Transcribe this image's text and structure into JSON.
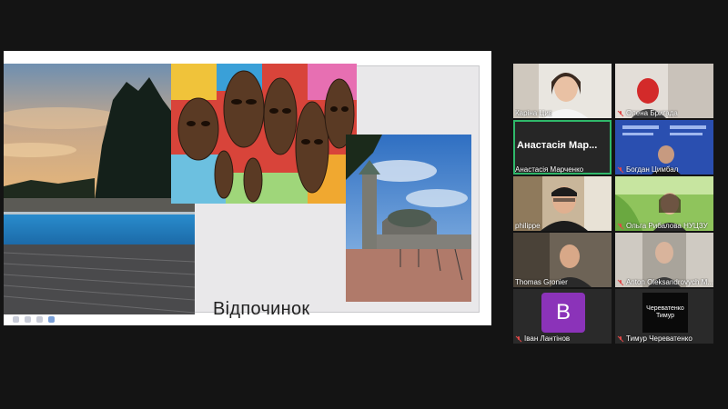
{
  "slide": {
    "title": "Відпочинок"
  },
  "participants": [
    {
      "name": "Каріна Цив",
      "muted": false,
      "kind": "video"
    },
    {
      "name": "Олена Бригада",
      "muted": true,
      "kind": "video"
    },
    {
      "name": "Анастасія Марченко",
      "muted": false,
      "kind": "name-card",
      "card_text": "Анастасія Мар..."
    },
    {
      "name": "Богдан Цимбал",
      "muted": true,
      "kind": "video"
    },
    {
      "name": "philippe",
      "muted": false,
      "kind": "video"
    },
    {
      "name": "Ольга Рибалова НУЦЗУ",
      "muted": true,
      "kind": "video"
    },
    {
      "name": "Thomas Gronier",
      "muted": false,
      "kind": "video"
    },
    {
      "name": "Anton Oleksandrovych M...",
      "muted": true,
      "kind": "video"
    },
    {
      "name": "Іван Лантінов",
      "muted": true,
      "kind": "avatar",
      "initial": "B"
    },
    {
      "name": "Тимур Череватенко",
      "muted": true,
      "kind": "avatar-text",
      "avatar_text": "Череватенко Тимур"
    }
  ],
  "colors": {
    "active_speaker": "#2fb86a",
    "avatar_purple": "#8b33b9",
    "muted_red": "#e04848"
  }
}
